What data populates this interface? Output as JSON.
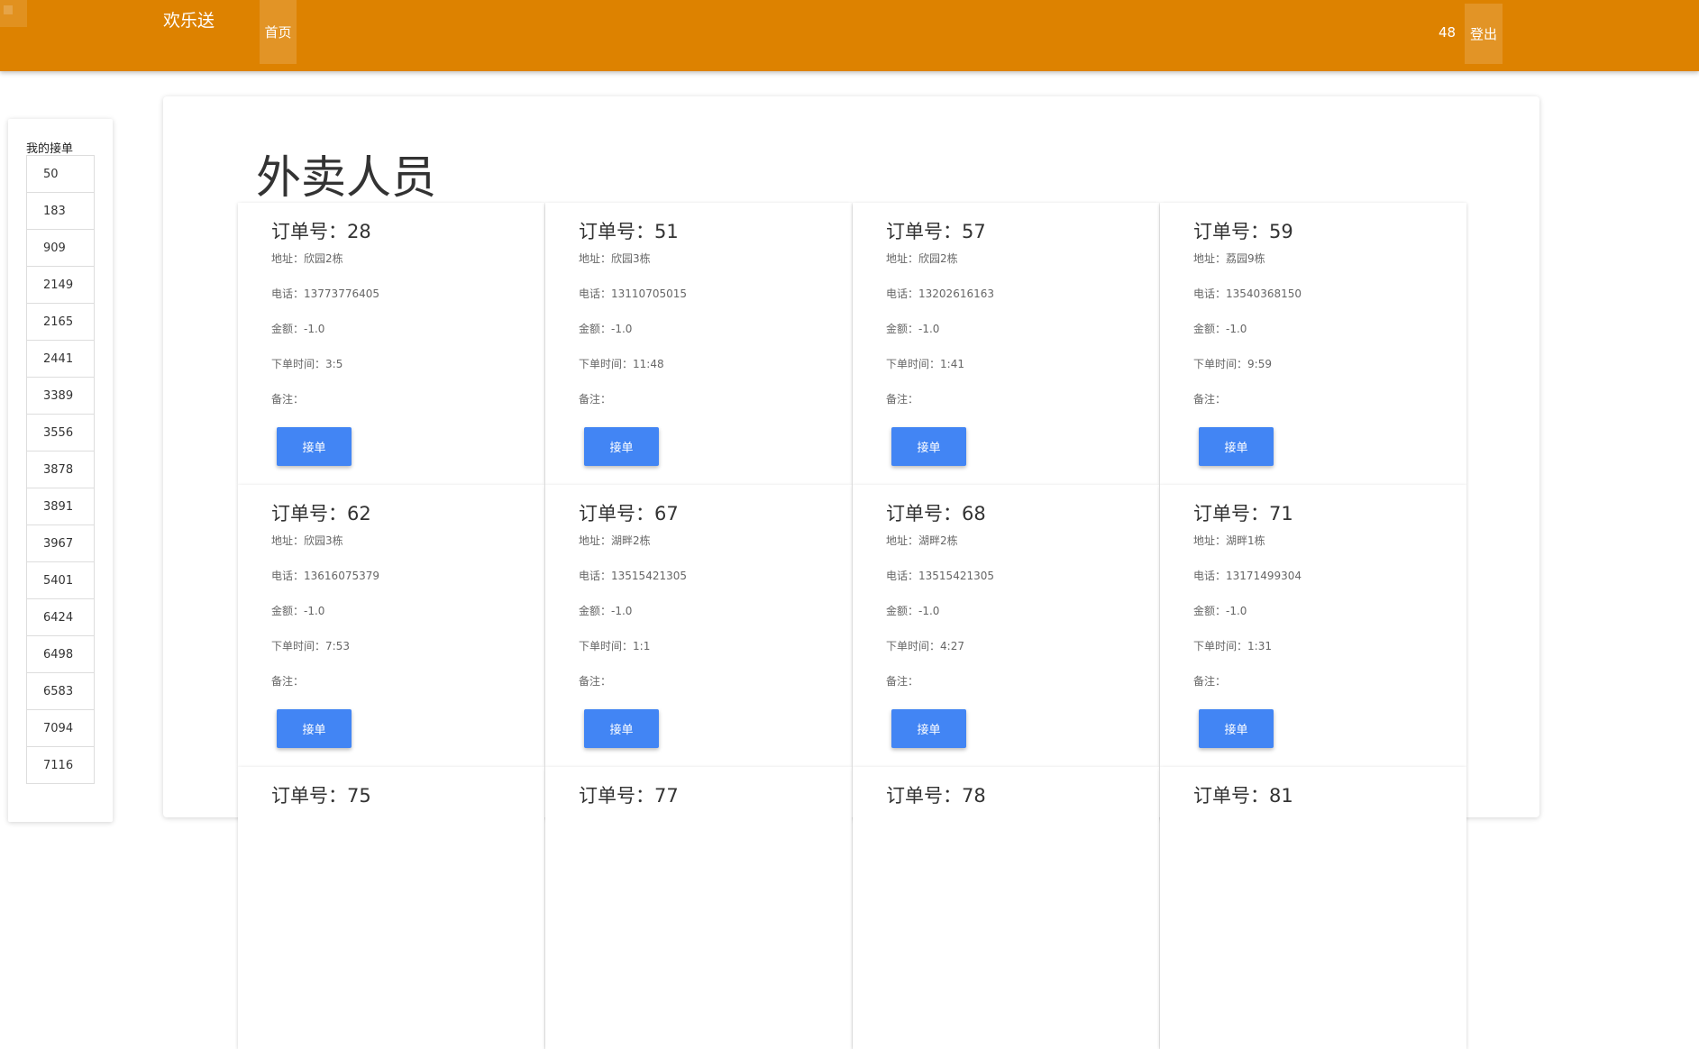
{
  "navbar": {
    "brand": "欢乐送",
    "home_label": "首页",
    "user_count": "48",
    "logout_label": "登出"
  },
  "sidebar": {
    "title": "我的接单",
    "orders": [
      "50",
      "183",
      "909",
      "2149",
      "2165",
      "2441",
      "3389",
      "3556",
      "3878",
      "3891",
      "3967",
      "5401",
      "6424",
      "6498",
      "6583",
      "7094",
      "7116"
    ]
  },
  "main": {
    "page_title": "外卖人员",
    "labels": {
      "order_no": "订单号：",
      "address": "地址：",
      "phone": "电话：",
      "amount": "金额：",
      "order_time": "下单时间：",
      "note": "备注：",
      "accept_button": "接单"
    },
    "orders": [
      {
        "order_no": "28",
        "address": "欣园2栋",
        "phone": "13773776405",
        "amount": "-1.0",
        "order_time": "3:5",
        "note": ""
      },
      {
        "order_no": "51",
        "address": "欣园3栋",
        "phone": "13110705015",
        "amount": "-1.0",
        "order_time": "11:48",
        "note": ""
      },
      {
        "order_no": "57",
        "address": "欣园2栋",
        "phone": "13202616163",
        "amount": "-1.0",
        "order_time": "1:41",
        "note": ""
      },
      {
        "order_no": "59",
        "address": "荔园9栋",
        "phone": "13540368150",
        "amount": "-1.0",
        "order_time": "9:59",
        "note": ""
      },
      {
        "order_no": "62",
        "address": "欣园3栋",
        "phone": "13616075379",
        "amount": "-1.0",
        "order_time": "7:53",
        "note": ""
      },
      {
        "order_no": "67",
        "address": "湖畔2栋",
        "phone": "13515421305",
        "amount": "-1.0",
        "order_time": "1:1",
        "note": ""
      },
      {
        "order_no": "68",
        "address": "湖畔2栋",
        "phone": "13515421305",
        "amount": "-1.0",
        "order_time": "4:27",
        "note": ""
      },
      {
        "order_no": "71",
        "address": "湖畔1栋",
        "phone": "13171499304",
        "amount": "-1.0",
        "order_time": "1:31",
        "note": ""
      },
      {
        "order_no": "75"
      },
      {
        "order_no": "77"
      },
      {
        "order_no": "78"
      },
      {
        "order_no": "81"
      }
    ]
  }
}
